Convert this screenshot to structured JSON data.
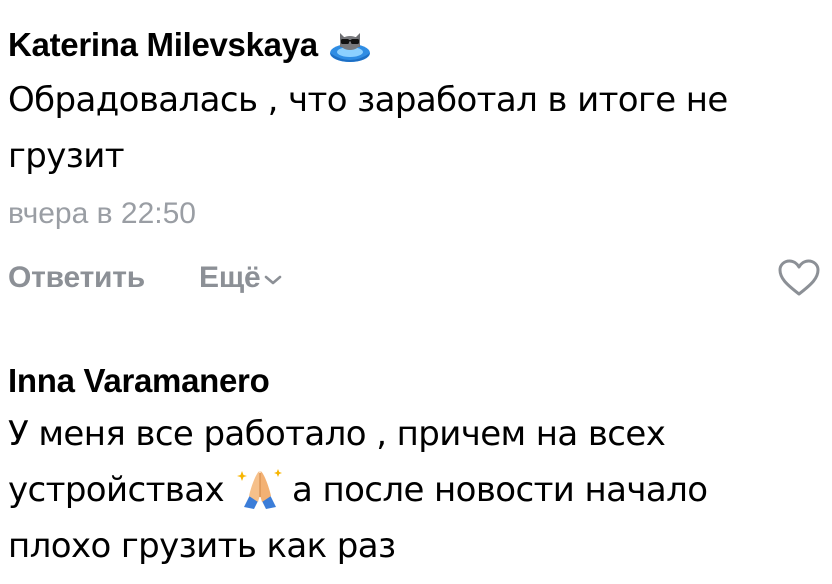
{
  "comments": [
    {
      "author": "Katerina Milevskaya",
      "badge_icon": "cat-sunglasses-pool-icon",
      "text_lines": [
        "Обрадовалась , что заработал в итоге не",
        "грузит"
      ],
      "time": "вчера в 22:50",
      "actions": {
        "reply": "Ответить",
        "more": "Ещё"
      },
      "like_icon": "heart-outline-icon"
    },
    {
      "author": "Inna Varamanero",
      "text_line1": "У меня все работало , причем на всех",
      "text_line2_before": "устройствах",
      "inline_emoji": "folded-hands-emoji",
      "text_line2_after": "а после новости начало",
      "text_line3": "плохо грузить как раз"
    }
  ],
  "colors": {
    "text": "#000000",
    "secondary": "#9a9ea4",
    "action": "#8c9096",
    "badge_blue": "#2f8de4"
  }
}
